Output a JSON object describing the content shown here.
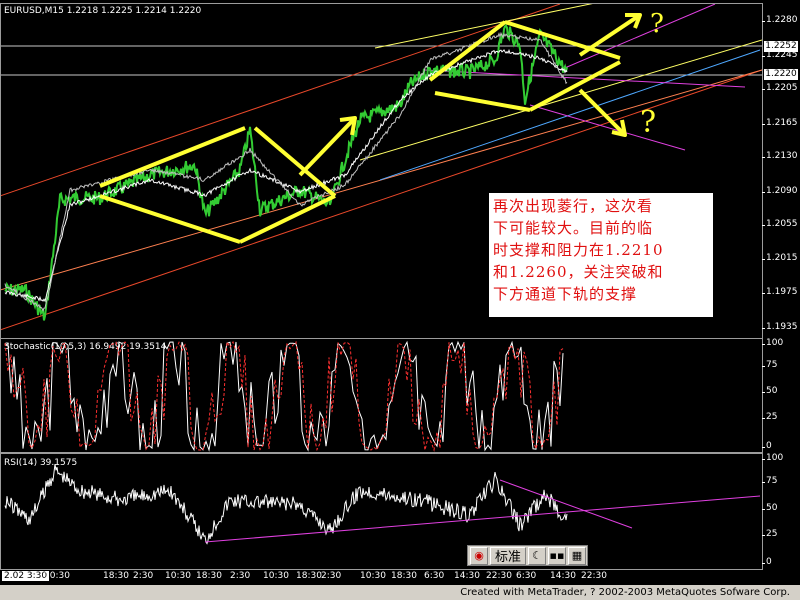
{
  "main": {
    "label": "EURUSD,M15  1.2218 1.2225 1.2214 1.2220",
    "price_ticks": [
      "1.2280",
      "1.2245",
      "1.2205",
      "1.2165",
      "1.2130",
      "1.2090",
      "1.2055",
      "1.2015",
      "1.1975",
      "1.1935"
    ],
    "price_markers": [
      {
        "value": "1.2252",
        "bg": "#ffffff"
      },
      {
        "value": "1.2220",
        "bg": "#ffffff"
      }
    ],
    "annotation_q1": "?",
    "annotation_q2": "?"
  },
  "note": {
    "lines": [
      "再次出现菱行，这次看",
      "下可能较大。目前的临",
      "时支撑和阻力在1.2210",
      "和1.2260，关注突破和",
      "下方通道下轨的支撑"
    ]
  },
  "stochastic": {
    "label": "Stochastic(10,5,3)  16.9492  19.3514",
    "ticks": [
      "100",
      "75",
      "50",
      "25",
      "0"
    ]
  },
  "rsi": {
    "label": "RSI(14)  39.1575",
    "ticks": [
      "100",
      "75",
      "50",
      "25",
      "0"
    ]
  },
  "time_axis": [
    "2.02 3:30",
    "10:30",
    "18:30",
    "2:30",
    "10:30",
    "18:30",
    "2:30",
    "10:30",
    "18:30",
    "2:30",
    "10:30",
    "18:30",
    "6:30",
    "14:30",
    "22:30",
    "6:30",
    "14:30",
    "22:30"
  ],
  "toolbar": {
    "label": "标准",
    "buttons": [
      "chart-icon",
      "moon-icon",
      "dots-icon",
      "grid-icon"
    ]
  },
  "status": {
    "text": "Created with MetaTrader, ? 2002-2003 MetaQuotes Sofware Corp."
  },
  "colors": {
    "channel_red": "#e8482a",
    "channel_yellow": "#ffff66",
    "magenta": "#e040e0",
    "yellow_marker": "#ffff33",
    "note_text": "#e01010",
    "price_line": "#33cc33"
  }
}
